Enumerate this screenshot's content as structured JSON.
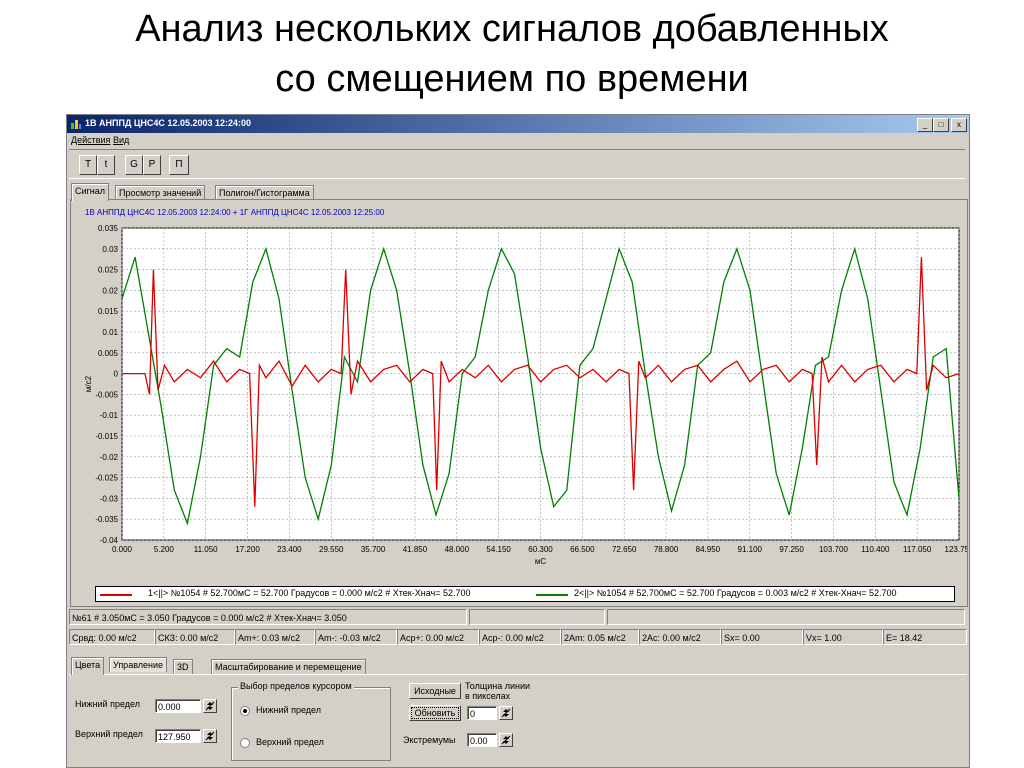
{
  "slide_title_line1": "Анализ нескольких сигналов добавленных",
  "slide_title_line2": "со смещением по времени",
  "window": {
    "title": "1В АНППД ЦНС4С 12.05.2003 12:24:00",
    "minimize": "_",
    "restore": "□",
    "close": "x"
  },
  "menu": [
    "Действия",
    "Вид"
  ],
  "toolbar": [
    "T",
    "t",
    "G",
    "P",
    "П"
  ],
  "tabs": [
    "Сигнал",
    "Просмотр значений",
    "Полигон/Гистограмма"
  ],
  "chart_header": "1В АНППД ЦНС4С 12.05.2003 12:24:00 + 1Г АНППД ЦНС4С 12.05.2003 12:25:00",
  "legend": {
    "series1": "1<||> №1054 # 52.700мС =  52.700 Градусов  = 0.000 м/с2  #  Хтек-Хнач=  52.700",
    "series2": "2<||> №1054 # 52.700мС =  52.700 Градусов  = 0.003 м/с2  #  Хтек-Хнач=  52.700"
  },
  "status1": {
    "cursor": "№61 #  3.050мС =   3.050 Градусов  = 0.000 м/с2  #  Хтек-Хнач=   3.050"
  },
  "status2": [
    "Срвд:  0.00 м/с2",
    "СКЗ:   0.00 м/с2",
    "Am+:  0.03 м/с2",
    "Am-:  -0.03 м/с2",
    "Аср+:  0.00 м/с2",
    "Аср-:  0.00 м/с2",
    "2Am:   0.05 м/с2",
    "2Ac:   0.00 м/с2",
    "Sx=     0.00",
    "Vx=     1.00",
    "E=     18.42"
  ],
  "bottom_tabs": [
    "Цвета",
    "Управление",
    "3D",
    "Масштабирование и перемещение"
  ],
  "controls": {
    "lower_limit_label": "Нижний предел",
    "lower_limit_value": "0.000",
    "upper_limit_label": "Верхний предел",
    "upper_limit_value": "127.950",
    "cursor_group_title": "Выбор пределов курсором",
    "radio_lower": "Нижний предел",
    "radio_upper": "Верхний предел",
    "original_button": "Исходные",
    "refresh_button": "Обновить",
    "line_thickness_label_1": "Толщина линии",
    "line_thickness_label_2": "в пикселах",
    "line_thickness_value": "0",
    "extremes_label": "Экстремумы",
    "extremes_value": "0.00"
  },
  "colors": {
    "series1": "#dd0000",
    "series2": "#008000",
    "titlebar": "#0a246a"
  },
  "chart_data": {
    "type": "line",
    "xlabel": "мС",
    "ylabel": "м/с2",
    "xlim": [
      0,
      127.95
    ],
    "ylim": [
      -0.04,
      0.035
    ],
    "grid": true,
    "x_ticks": [
      "0.000",
      "5.200",
      "11.050",
      "17.200",
      "23.400",
      "29.550",
      "35.700",
      "41.850",
      "48.000",
      "54.150",
      "60.300",
      "66.500",
      "72.650",
      "78.800",
      "84.950",
      "91.100",
      "97.250",
      "103.700",
      "110.400",
      "117.050",
      "123.750"
    ],
    "y_ticks": [
      "0.035",
      "0.03",
      "0.025",
      "0.02",
      "0.015",
      "0.01",
      "0.005",
      "0",
      "-0.005",
      "-0.01",
      "-0.015",
      "-0.02",
      "-0.025",
      "-0.03",
      "-0.035",
      "-0.04"
    ],
    "series": [
      {
        "name": "1",
        "color": "#dd0000",
        "x": [
          0,
          3.5,
          4.2,
          4.8,
          5.5,
          6.5,
          8,
          10,
          12,
          14,
          16,
          18,
          19.5,
          20.3,
          21,
          22,
          24,
          26,
          28,
          30,
          32,
          33.5,
          34.2,
          35,
          36,
          38,
          40,
          42,
          44,
          46,
          47.5,
          48.1,
          48.8,
          50,
          52,
          54,
          56,
          58,
          60,
          62,
          64,
          66,
          68,
          70,
          72,
          74,
          76,
          77.5,
          78.2,
          79,
          80,
          82,
          84,
          86,
          88,
          90,
          92,
          94,
          96,
          98,
          100,
          102,
          104,
          105.5,
          106.2,
          107,
          108,
          110,
          112,
          114,
          116,
          118,
          120,
          121.5,
          122.2,
          123,
          124,
          126,
          127.95
        ],
        "y": [
          0,
          0,
          -0.005,
          0.025,
          -0.004,
          0.002,
          -0.002,
          0.001,
          -0.001,
          0.003,
          -0.002,
          0.001,
          0,
          -0.032,
          0.002,
          -0.001,
          0.003,
          -0.003,
          0.002,
          -0.002,
          0.001,
          0,
          0.025,
          -0.005,
          0.003,
          -0.002,
          0.001,
          0.002,
          -0.002,
          0.001,
          0,
          -0.028,
          0.003,
          -0.002,
          0.001,
          -0.001,
          0.002,
          -0.002,
          0.001,
          0.002,
          -0.002,
          0.001,
          0.002,
          -0.001,
          0.001,
          -0.002,
          0.001,
          0,
          -0.028,
          0.003,
          -0.001,
          0.002,
          -0.002,
          0.001,
          0.002,
          -0.002,
          0.001,
          0.003,
          -0.002,
          0.001,
          0.002,
          -0.002,
          0.001,
          0,
          -0.022,
          0.004,
          -0.002,
          0.002,
          -0.002,
          0.001,
          0.002,
          -0.002,
          0.001,
          0,
          0.028,
          -0.004,
          0.002,
          -0.001,
          0
        ]
      },
      {
        "name": "2",
        "color": "#008000",
        "x": [
          0,
          2,
          4,
          6,
          8,
          10,
          12,
          14,
          16,
          18,
          20,
          22,
          24,
          26,
          28,
          30,
          32,
          34,
          36,
          38,
          40,
          42,
          44,
          46,
          48,
          50,
          52,
          54,
          56,
          58,
          60,
          62,
          64,
          66,
          68,
          70,
          72,
          74,
          76,
          78,
          80,
          82,
          84,
          86,
          88,
          90,
          92,
          94,
          96,
          98,
          100,
          102,
          104,
          106,
          108,
          110,
          112,
          114,
          116,
          118,
          120,
          122,
          124,
          126,
          127.95
        ],
        "y": [
          0.018,
          0.028,
          0.01,
          -0.008,
          -0.028,
          -0.036,
          -0.02,
          0.002,
          0.006,
          0.004,
          0.022,
          0.03,
          0.018,
          -0.004,
          -0.025,
          -0.035,
          -0.022,
          0.004,
          -0.002,
          0.02,
          0.03,
          0.02,
          0.0,
          -0.022,
          -0.034,
          -0.024,
          0.0,
          0.004,
          0.02,
          0.03,
          0.024,
          0.004,
          -0.018,
          -0.032,
          -0.028,
          0.002,
          0.006,
          0.018,
          0.03,
          0.022,
          0.0,
          -0.02,
          -0.033,
          -0.022,
          0.002,
          0.005,
          0.022,
          0.03,
          0.02,
          -0.002,
          -0.024,
          -0.034,
          -0.018,
          0.002,
          0.004,
          0.02,
          0.03,
          0.018,
          -0.004,
          -0.026,
          -0.034,
          -0.018,
          0.004,
          0.006,
          -0.03
        ]
      }
    ]
  }
}
